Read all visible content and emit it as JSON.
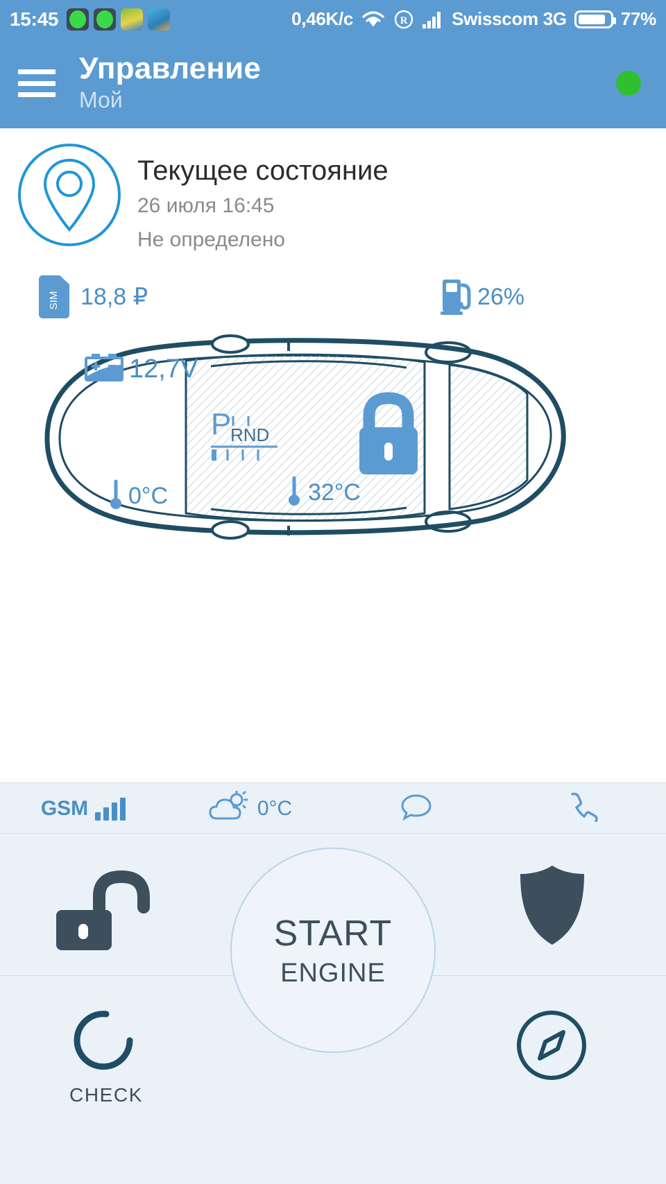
{
  "status_bar": {
    "time": "15:45",
    "data_rate": "0,46K/c",
    "carrier": "Swisscom 3G",
    "battery_percent": "77%",
    "icons": [
      "app-icon-1",
      "app-icon-2",
      "app-icon-3",
      "app-icon-4",
      "wifi-icon",
      "roaming-icon",
      "signal-icon",
      "battery-icon"
    ]
  },
  "header": {
    "menu_icon": "hamburger-icon",
    "title": "Управление",
    "subtitle": "Мой",
    "status_dot_color": "#2fbf2f"
  },
  "status_card": {
    "icon": "location-pin-icon",
    "title": "Текущее состояние",
    "timestamp": "26 июля 16:45",
    "location": "Не определено"
  },
  "gauges": {
    "sim": {
      "icon": "sim-card-icon",
      "label": "SIM",
      "value": "18,8 ₽"
    },
    "fuel": {
      "icon": "fuel-pump-icon",
      "value": "26%"
    }
  },
  "car": {
    "battery": {
      "icon": "car-battery-icon",
      "value": "12,7V"
    },
    "engine_temp": {
      "icon": "thermometer-icon",
      "value": "0°C"
    },
    "cabin_temp": {
      "icon": "thermometer-icon",
      "value": "32°C"
    },
    "gear": {
      "icon": "gear-selector-icon",
      "positions": [
        "P",
        "R",
        "N",
        "D"
      ],
      "active": "P"
    },
    "lock_state": {
      "icon": "lock-closed-icon",
      "locked": true
    }
  },
  "info_bar": {
    "gsm": {
      "label": "GSM",
      "icon": "signal-bars-icon"
    },
    "weather": {
      "icon": "cloud-sun-icon",
      "temperature": "0°C"
    },
    "chat": {
      "icon": "chat-bubble-icon"
    },
    "call": {
      "icon": "phone-icon"
    }
  },
  "actions": {
    "unlock": {
      "icon": "unlock-icon"
    },
    "start": {
      "main_label": "START",
      "sub_label": "ENGINE"
    },
    "shield": {
      "icon": "shield-icon"
    },
    "check": {
      "icon": "refresh-icon",
      "label": "CHECK"
    },
    "compass": {
      "icon": "compass-icon"
    }
  },
  "colors": {
    "header_blue": "#5b9bd1",
    "accent_blue": "#4a8fc4",
    "dark_outline": "#1f4d63",
    "panel_bg": "#eaf1f7"
  }
}
